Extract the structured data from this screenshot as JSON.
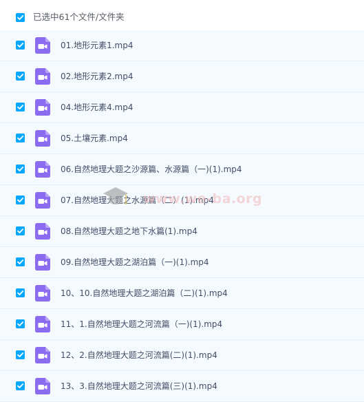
{
  "header": {
    "selection_text": "已选中61个文件/文件夹"
  },
  "files": [
    {
      "name": "01.地形元素1.mp4"
    },
    {
      "name": "02.地形元素2.mp4"
    },
    {
      "name": "04.地形元素4.mp4"
    },
    {
      "name": "05.土壤元素.mp4"
    },
    {
      "name": "06.自然地理大题之沙源篇、水源篇（一)(1).mp4"
    },
    {
      "name": "07.自然地理大题之水源篇（二）(1).mp4"
    },
    {
      "name": "08.自然地理大题之地下水篇(1).mp4"
    },
    {
      "name": "09.自然地理大题之湖泊篇（一)(1).mp4"
    },
    {
      "name": "10、10.自然地理大题之湖泊篇（二)(1).mp4"
    },
    {
      "name": "11、1.自然地理大题之河流篇（一)(1).mp4"
    },
    {
      "name": "12、2.自然地理大题之河流篇(二)(1).mp4"
    },
    {
      "name": "13、3.自然地理大题之河流篇(三)(1).mp4"
    }
  ],
  "watermark": {
    "text": "www.we-ba.org"
  },
  "colors": {
    "checkbox": "#06a7ff",
    "video_icon": "#8b6cf0",
    "row_background": "#f5fafe"
  },
  "icons": {
    "checkbox": "checkbox-checked-icon",
    "file": "video-file-icon"
  }
}
